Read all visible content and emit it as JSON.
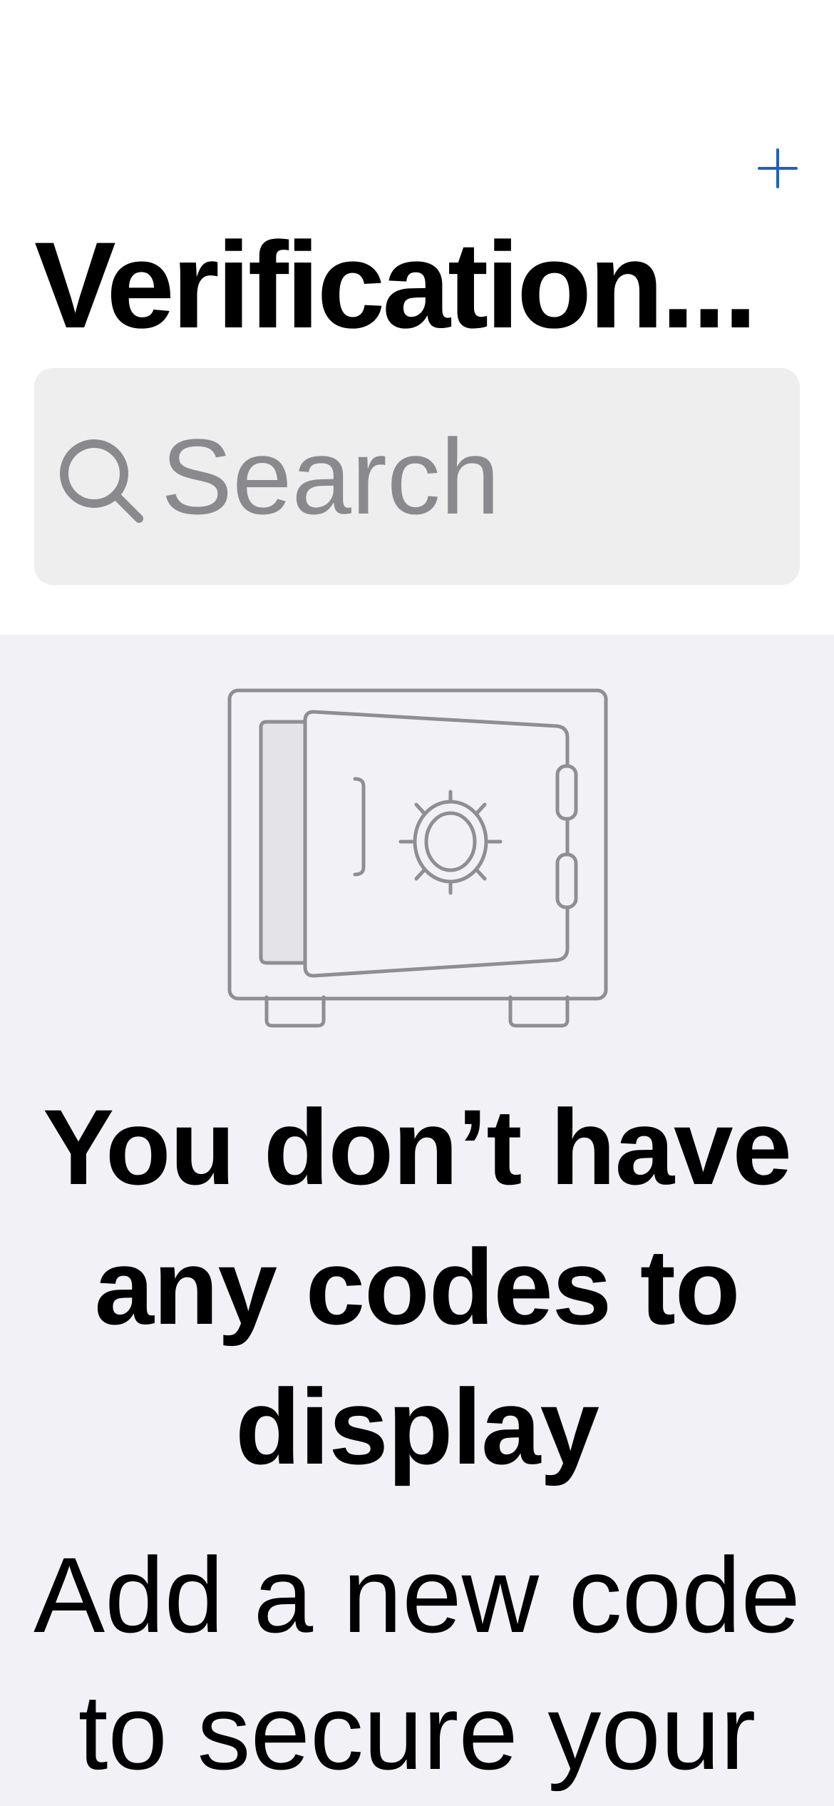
{
  "header": {
    "title": "Verification...",
    "add_icon": "plus-icon",
    "accent_color": "#1f5fbf"
  },
  "search": {
    "placeholder": "Search",
    "icon": "magnifying-glass-icon"
  },
  "empty_state": {
    "illustration": "safe-icon",
    "title": "You don’t have any codes to display",
    "subtitle": "Add a new code to secure your"
  },
  "colors": {
    "background_top": "#ffffff",
    "background_empty": "#f2f1f6",
    "search_bg": "#eeeeef",
    "placeholder": "#8a8a8e",
    "illustration_stroke": "#8e8e93"
  }
}
